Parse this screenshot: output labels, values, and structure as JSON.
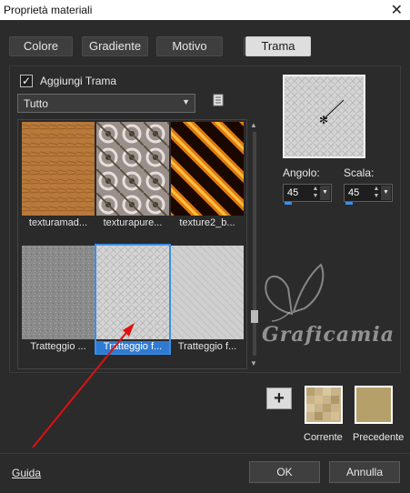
{
  "window": {
    "title": "Proprietà materiali",
    "close_glyph": "✕"
  },
  "tabs": [
    {
      "label": "Colore",
      "active": false
    },
    {
      "label": "Gradiente",
      "active": false
    },
    {
      "label": "Motivo",
      "active": false
    },
    {
      "label": "Trama",
      "active": true
    }
  ],
  "texture": {
    "add_checkbox_label": "Aggiungi Trama",
    "add_checkbox_checked": true,
    "category_value": "Tutto",
    "thumbnails": [
      {
        "caption": "texturamad...",
        "selected": false
      },
      {
        "caption": "texturapure...",
        "selected": false
      },
      {
        "caption": "texture2_b...",
        "selected": false
      },
      {
        "caption": "Tratteggio ...",
        "selected": false
      },
      {
        "caption": "Tratteggio f...",
        "selected": true
      },
      {
        "caption": "Tratteggio f...",
        "selected": false
      }
    ],
    "angle_label": "Angolo:",
    "angle_value": "45",
    "scale_label": "Scala:",
    "scale_value": "45"
  },
  "watermark": "Graficamia",
  "swatches": {
    "current_label": "Corrente",
    "previous_label": "Precedente",
    "current_color": "#c8b48a",
    "previous_color": "#b6a06a"
  },
  "footer": {
    "help_label": "Guida",
    "ok_label": "OK",
    "cancel_label": "Annulla"
  },
  "colors": {
    "accent": "#3a8fe6",
    "annotation_arrow": "#e01010"
  }
}
